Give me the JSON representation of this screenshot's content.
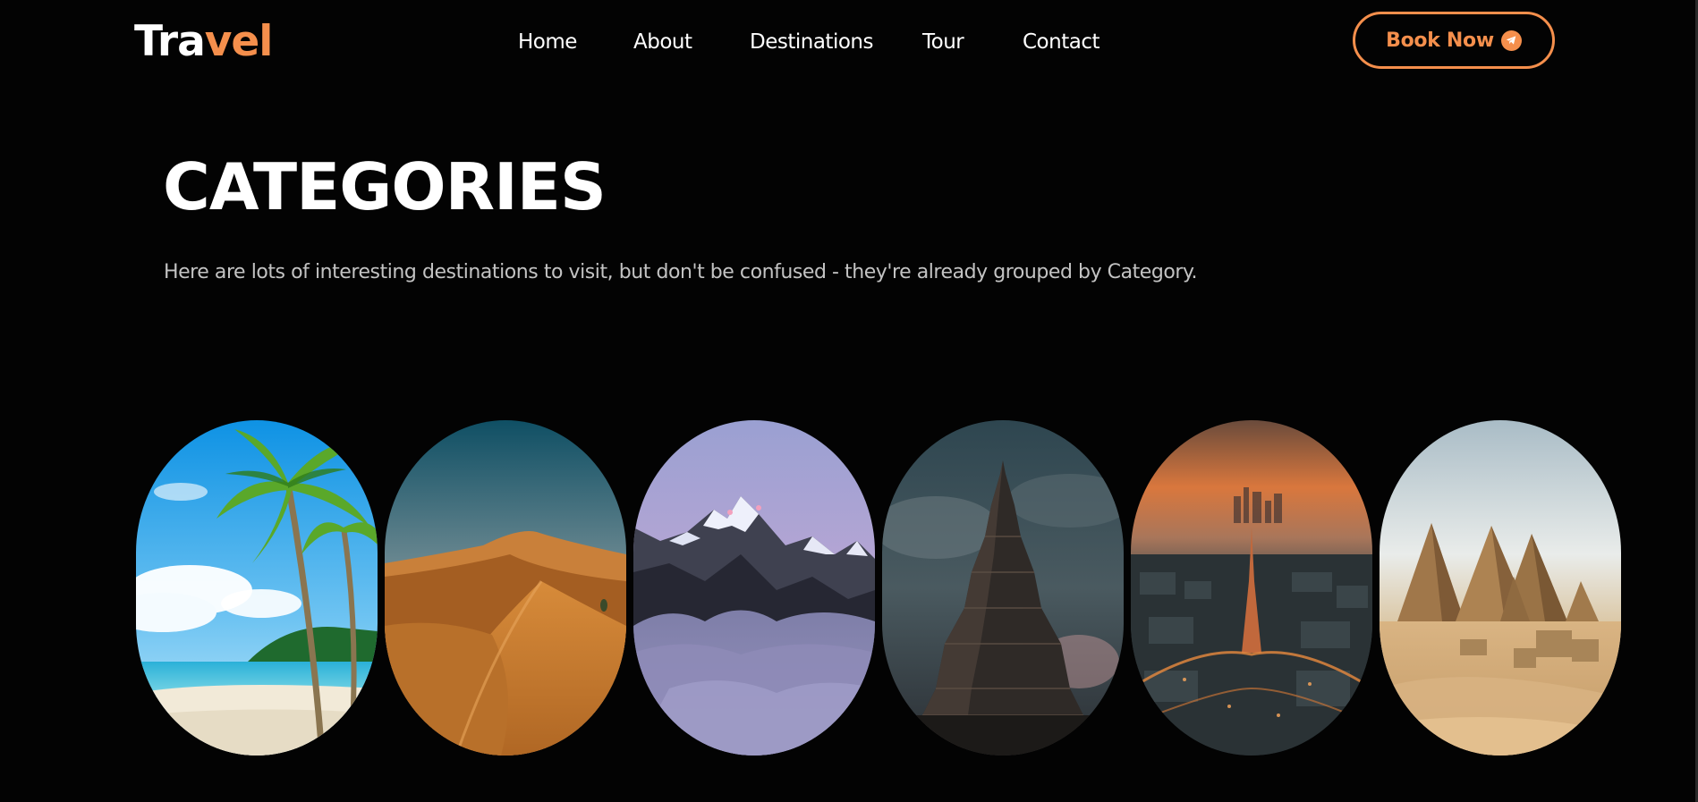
{
  "header": {
    "logo": {
      "part1": "Tra",
      "part2": "vel"
    },
    "nav": [
      "Home",
      "About",
      "Destinations",
      "Tour",
      "Contact"
    ],
    "cta": {
      "label": "Book Now",
      "icon": "send-icon"
    }
  },
  "hero": {
    "title": "CATEGORIES",
    "subtitle": "Here are lots of interesting destinations to visit, but don't be confused - they're already grouped by Category."
  },
  "categories": [
    {
      "image": "beach-palm-image"
    },
    {
      "image": "desert-dunes-image"
    },
    {
      "image": "snowy-mountains-image"
    },
    {
      "image": "ancient-temple-image"
    },
    {
      "image": "city-tower-image"
    },
    {
      "image": "pyramids-image"
    }
  ],
  "colors": {
    "accent": "#f58f4c",
    "background": "#030303",
    "text": "#ffffff",
    "muted": "#c3c3c3"
  }
}
